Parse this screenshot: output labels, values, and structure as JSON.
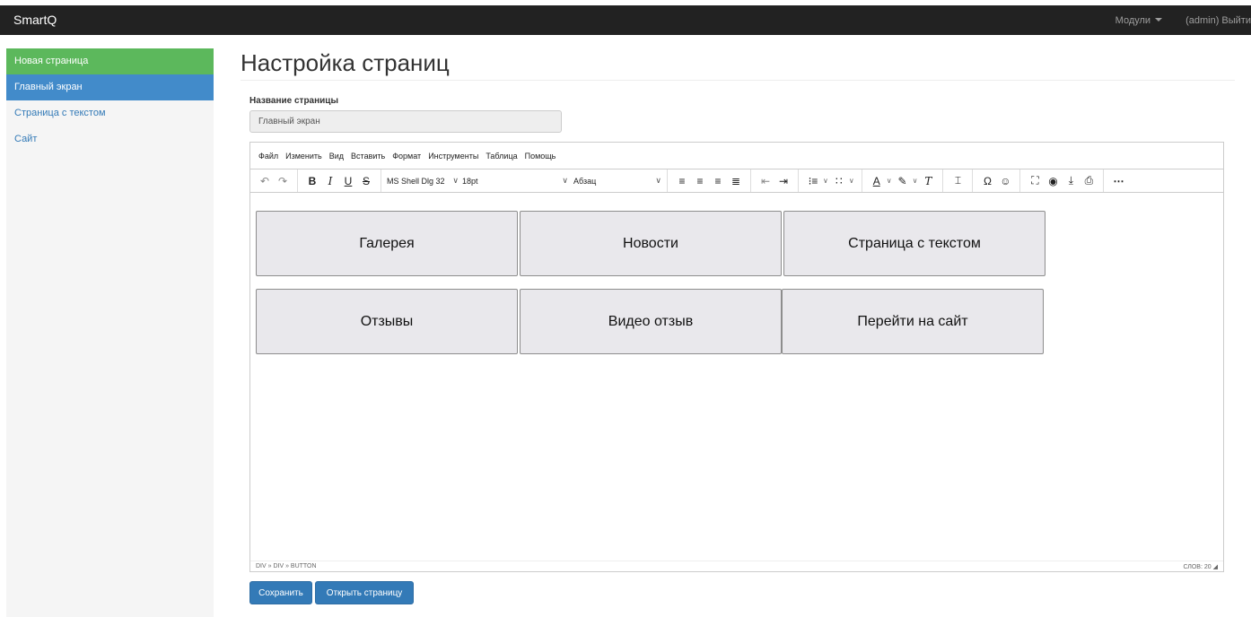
{
  "navbar": {
    "brand": "SmartQ",
    "modules": "Модули",
    "logout": "(admin) Выйти"
  },
  "sidebar": {
    "items": [
      {
        "label": "Новая страница"
      },
      {
        "label": "Главный экран"
      },
      {
        "label": "Страница с текстом"
      },
      {
        "label": "Сайт"
      }
    ]
  },
  "page": {
    "title": "Настройка страниц",
    "field_label": "Название страницы",
    "field_value": "Главный экран"
  },
  "editor": {
    "menu": [
      "Файл",
      "Изменить",
      "Вид",
      "Вставить",
      "Формат",
      "Инструменты",
      "Таблица",
      "Помощь"
    ],
    "font_family": "MS Shell Dlg 32",
    "font_size": "18pt",
    "block_format": "Абзац",
    "buttons": [
      "Галерея",
      "Новости",
      "Страница с текстом",
      "Отзывы",
      "Видео отзыв",
      "Перейти на сайт"
    ],
    "path": "DIV » DIV » BUTTON",
    "word_count": "СЛОВ: 20"
  },
  "actions": {
    "save": "Сохранить",
    "open": "Открыть страницу"
  }
}
